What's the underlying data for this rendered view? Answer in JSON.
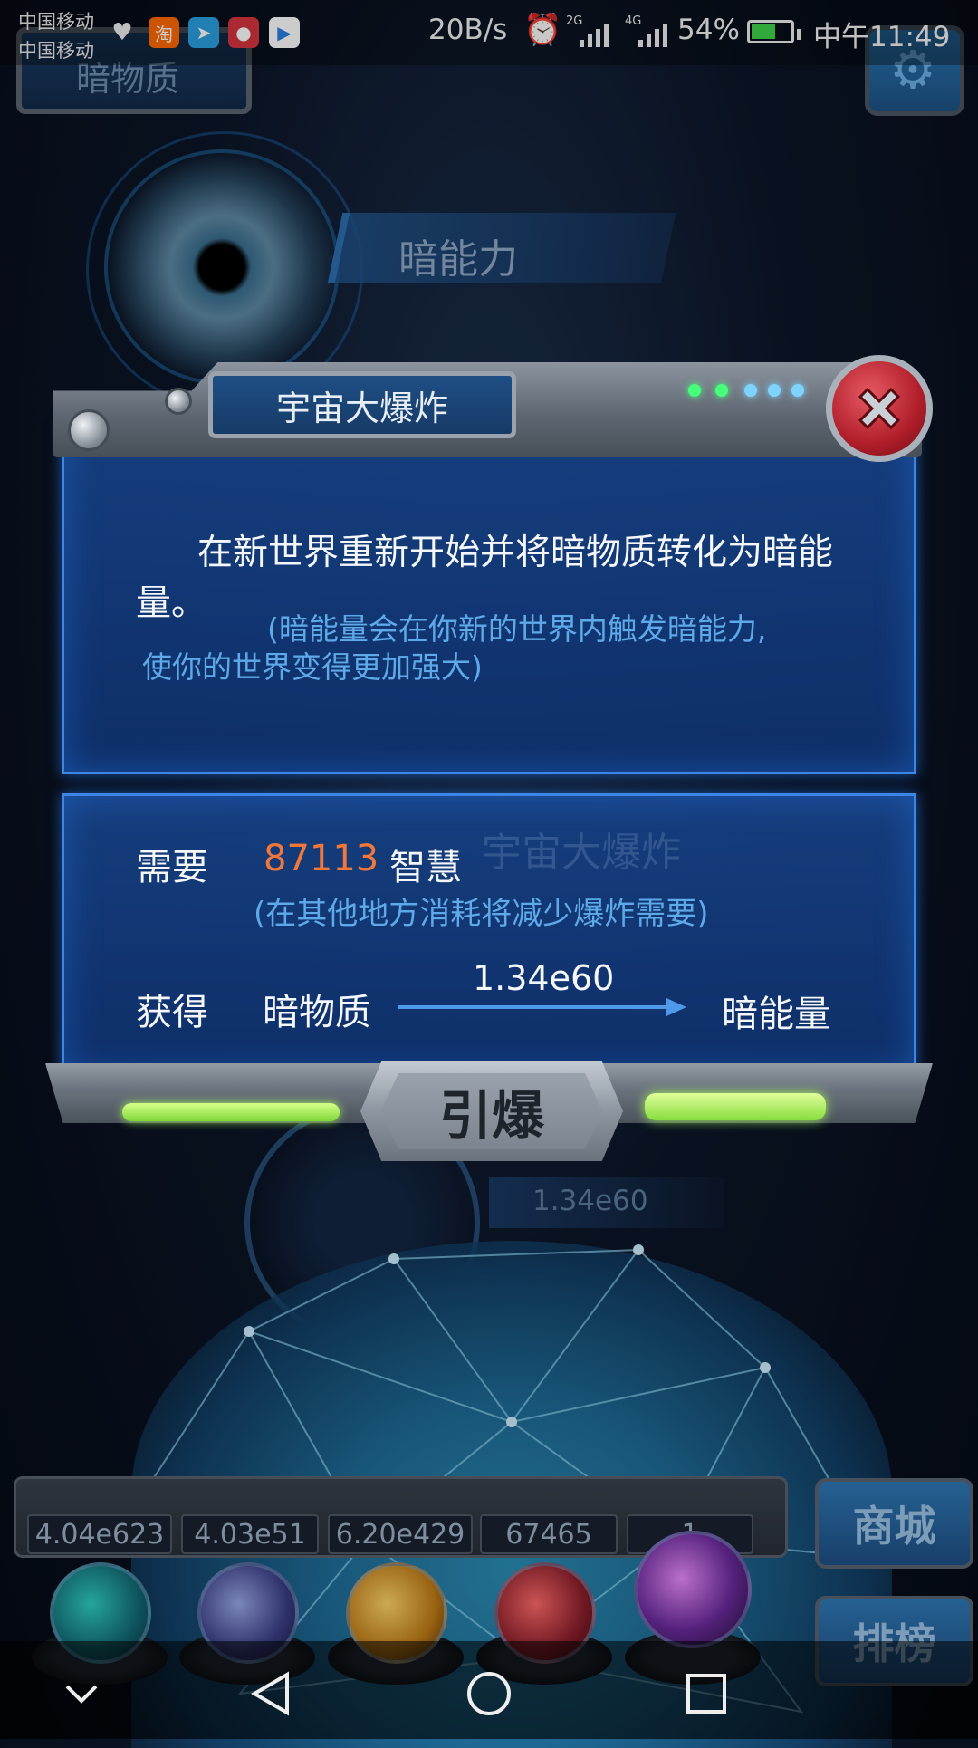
{
  "status_bar": {
    "carrier_1": "中国移动",
    "carrier_2": "中国移动",
    "net_speed": "20B/s",
    "signal_2g": "2G",
    "signal_4g": "4G",
    "battery": "54%",
    "time": "中午11:49",
    "app_icons": [
      "health-icon",
      "taobao-icon",
      "paper-plane-icon",
      "red-app-icon",
      "video-app-icon"
    ]
  },
  "background": {
    "top_tab": "暗物质",
    "dark_ability": "暗能力",
    "lower_value": "1.34e60",
    "resources": [
      "4.04e623",
      "4.03e51",
      "6.20e429",
      "67465",
      "1"
    ],
    "side_buttons": {
      "shop": "商城",
      "rank": "排榜"
    }
  },
  "dialog": {
    "title": "宇宙大爆炸",
    "description": "在新世界重新开始并将暗物质转化为暗能量。",
    "note_line1": "(暗能量会在你新的世界内触发暗能力,",
    "note_line2": "使你的世界变得更加强大)",
    "ghost_title": "宇宙大爆炸",
    "require_label": "需要",
    "require_amount": "87113",
    "require_unit": "智慧",
    "require_note": "(在其他地方消耗将减少爆炸需要)",
    "gain_label": "获得",
    "gain_from": "暗物质",
    "gain_amount": "1.34e60",
    "gain_to": "暗能量",
    "detonate_label": "引爆"
  },
  "colors": {
    "accent_orange": "#f2773a",
    "note_blue": "#5ea9e8",
    "panel_blue": "#16408a",
    "close_red": "#b01e2a"
  }
}
